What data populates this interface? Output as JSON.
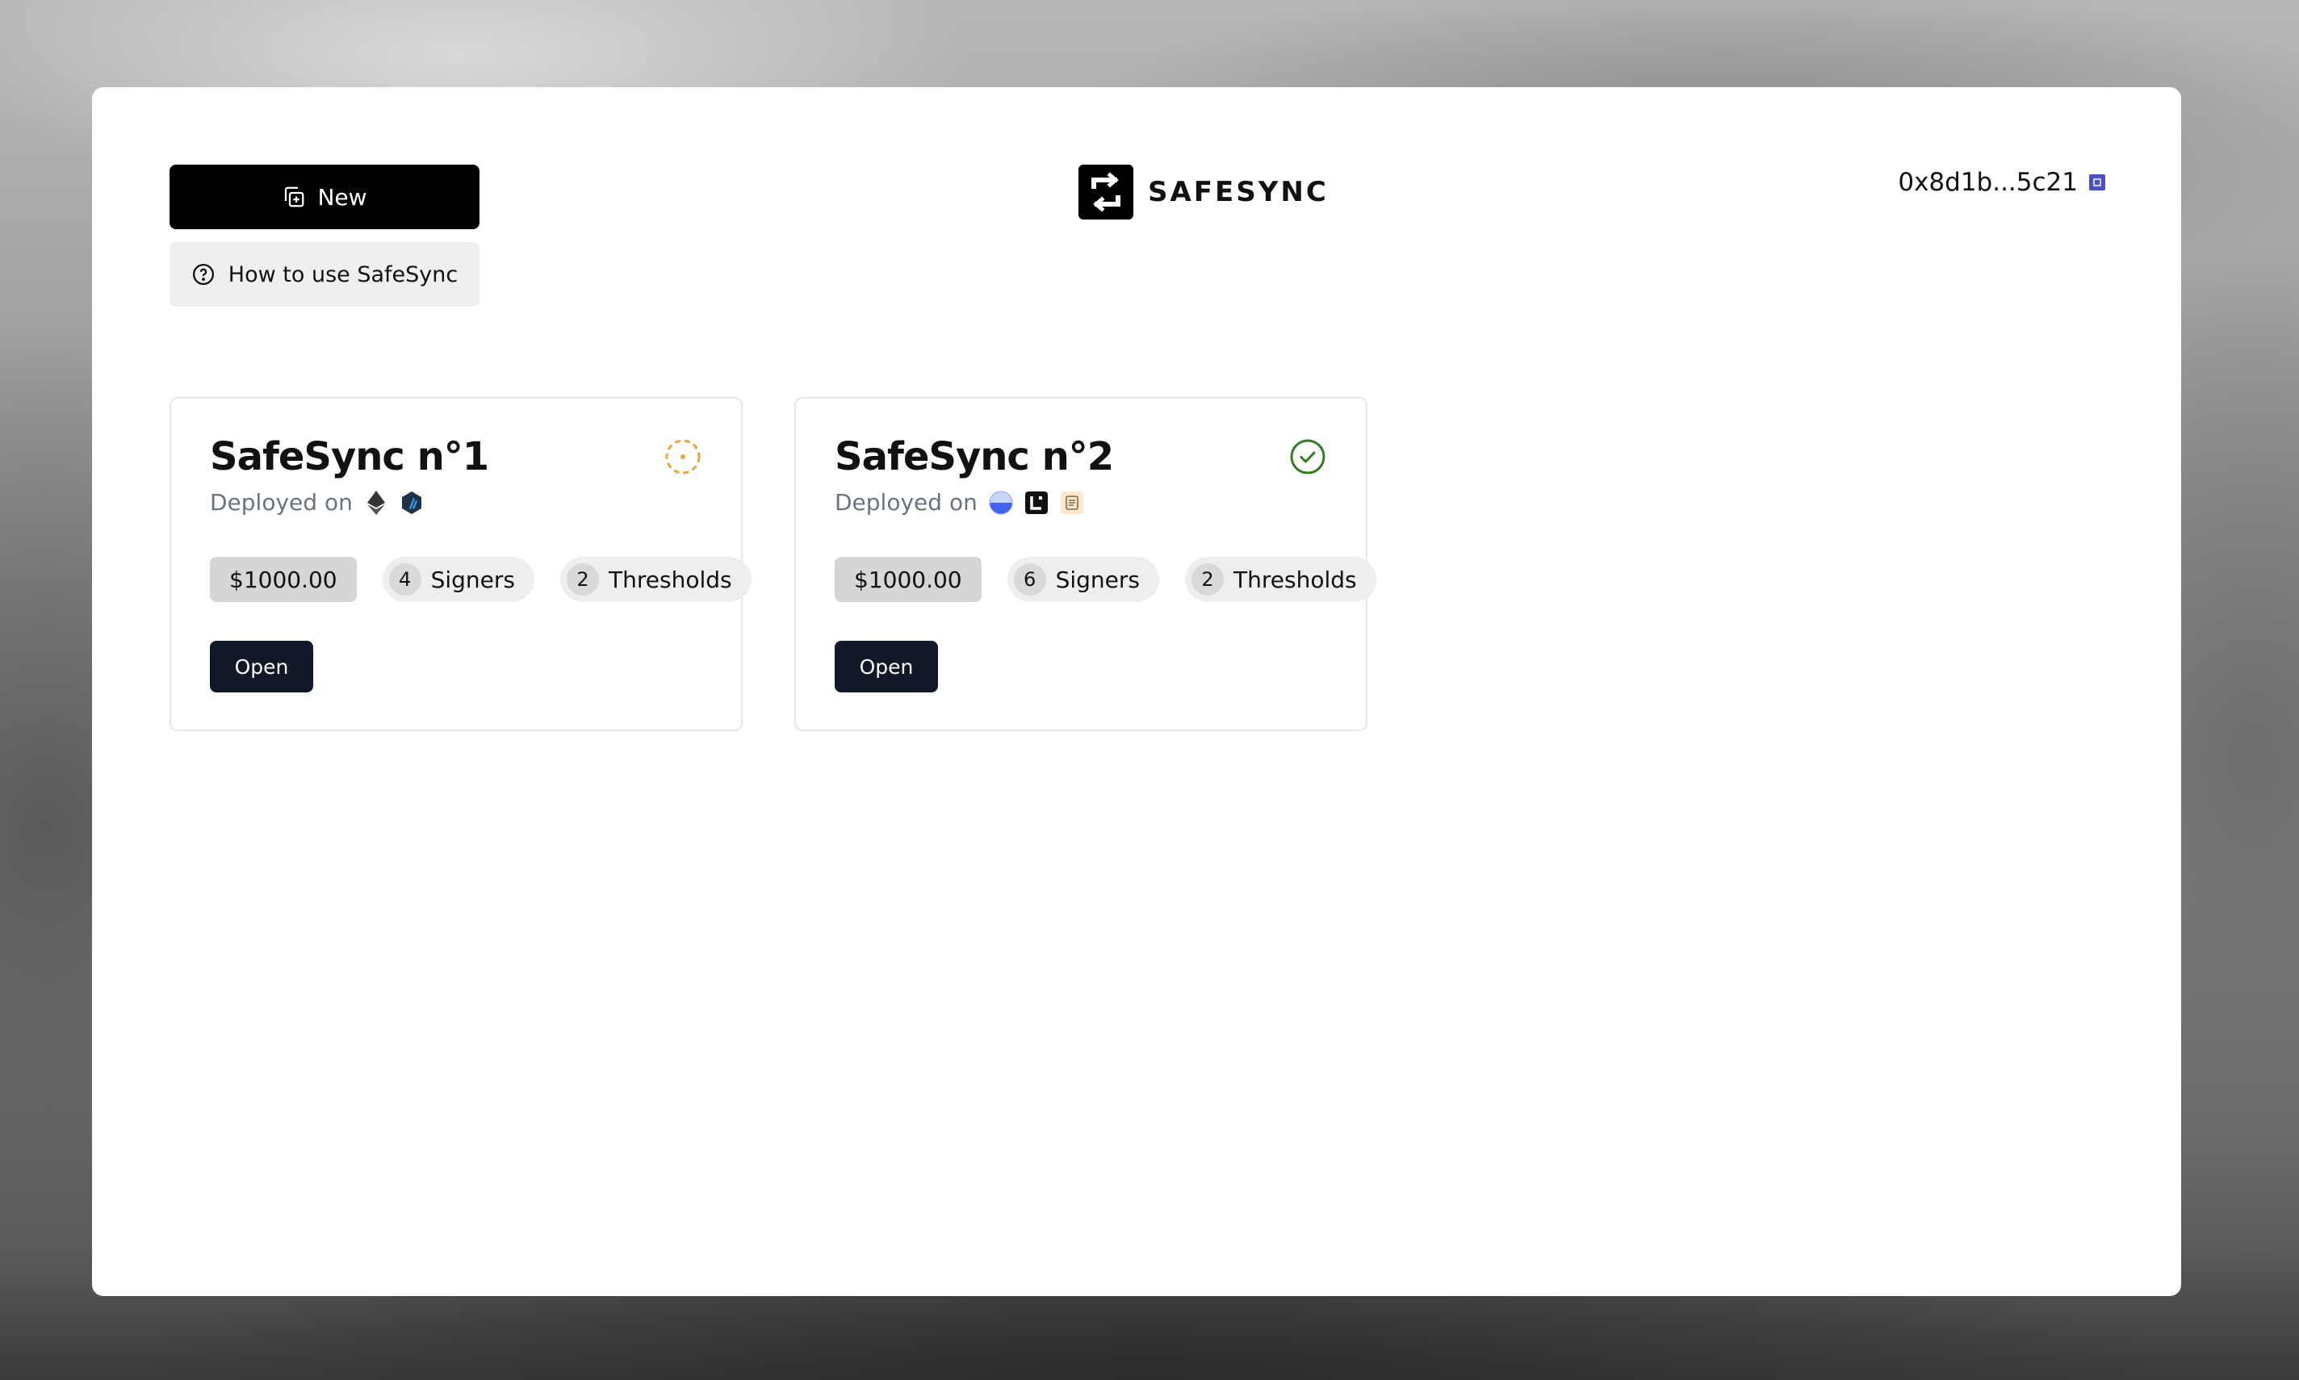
{
  "header": {
    "new_label": "New",
    "help_label": "How to use SafeSync",
    "brand": "SAFESYNC",
    "wallet_address": "0x8d1b...5c21"
  },
  "safes": [
    {
      "title": "SafeSync n°1",
      "status": "pending",
      "status_color": "#f0a23a",
      "deployed_label": "Deployed on",
      "chains": [
        "ethereum-icon",
        "arbitrum-icon"
      ],
      "balance": "$1000.00",
      "signers_count": "4",
      "signers_label": "Signers",
      "thresholds_count": "2",
      "thresholds_label": "Thresholds",
      "open_label": "Open"
    },
    {
      "title": "SafeSync n°2",
      "status": "deployed",
      "status_color": "#2f7d1f",
      "deployed_label": "Deployed on",
      "chains": [
        "base-icon",
        "linea-icon",
        "scroll-icon"
      ],
      "balance": "$1000.00",
      "signers_count": "6",
      "signers_label": "Signers",
      "thresholds_count": "2",
      "thresholds_label": "Thresholds",
      "open_label": "Open"
    }
  ]
}
